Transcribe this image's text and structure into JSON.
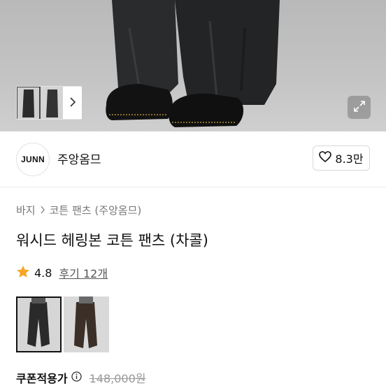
{
  "shop": {
    "logo_text": "JUNN",
    "name": "주앙옴므",
    "like_count": "8.3만"
  },
  "breadcrumb": [
    "바지",
    "코튼 팬츠 (주앙옴므)"
  ],
  "product": {
    "title": "워시드 헤링본 코튼 팬츠 (차콜)",
    "rating": "4.8",
    "reviews_label": "후기 12개"
  },
  "price": {
    "label": "쿠폰적용가",
    "original": "148,000원"
  },
  "icons": {
    "next": "chevron-right-icon",
    "expand": "expand-icon",
    "like": "heart-outline-icon",
    "star": "star-icon",
    "info": "info-circle-icon"
  },
  "colors": {
    "star": "#f5a623",
    "text": "#111111",
    "muted": "#777777"
  }
}
